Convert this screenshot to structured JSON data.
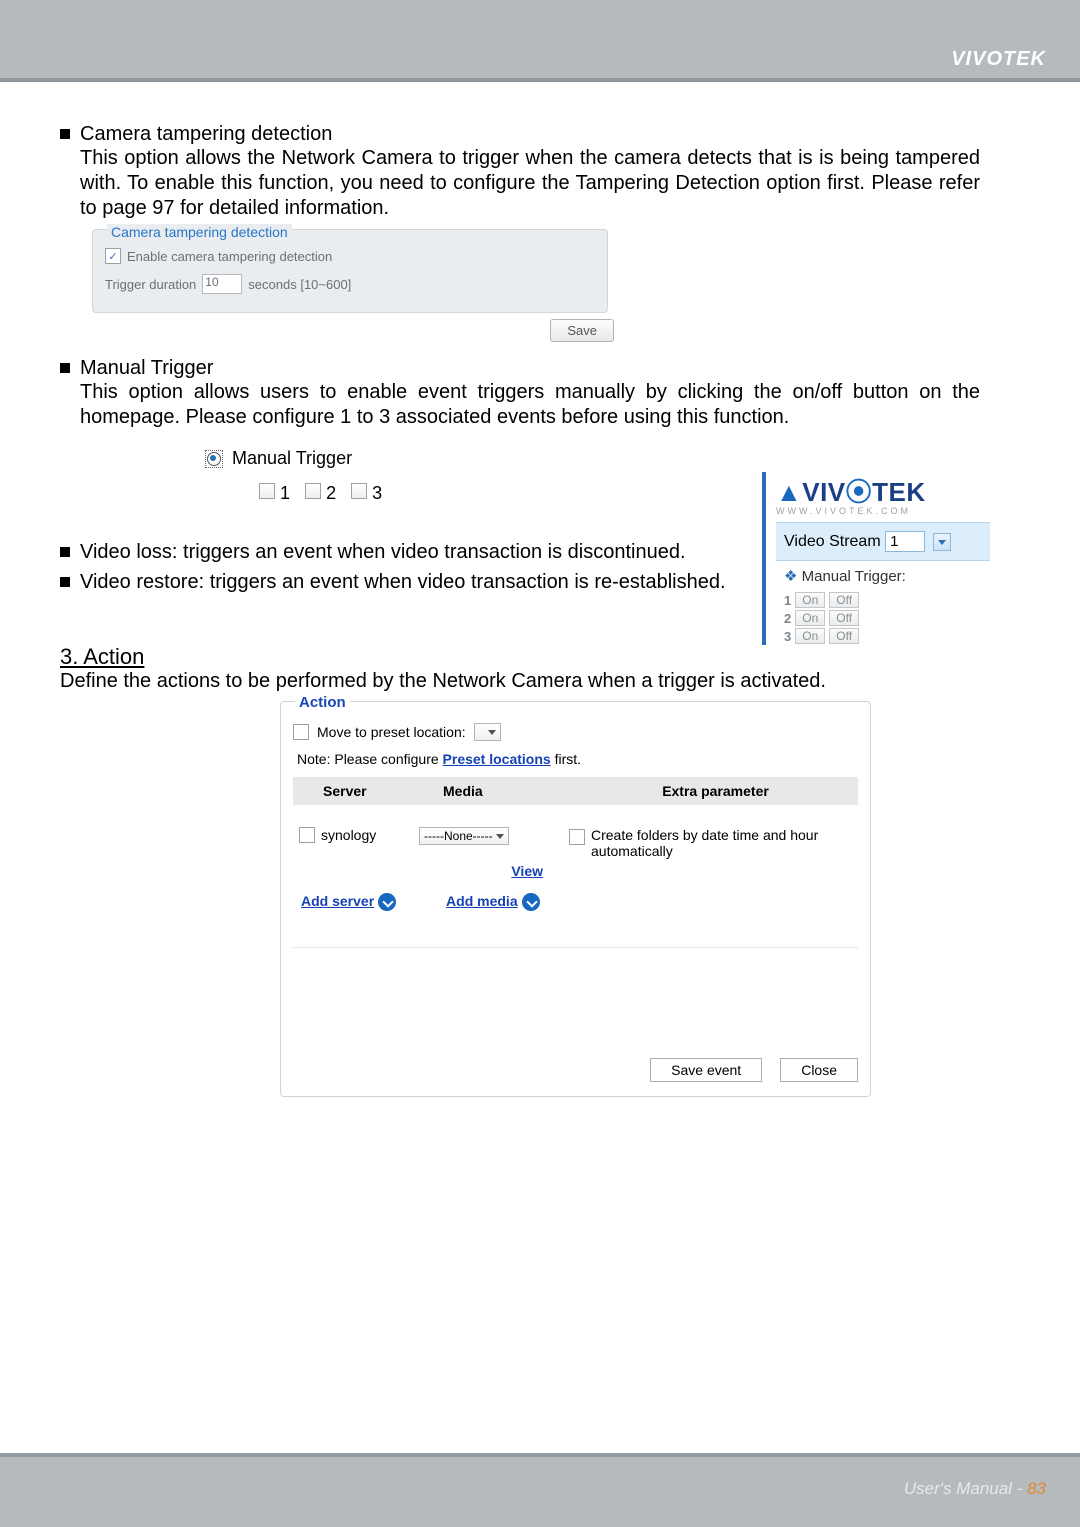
{
  "header": {
    "brand": "VIVOTEK"
  },
  "tampering": {
    "title": "Camera tampering detection",
    "description": "This option allows the Network Camera to trigger when the camera detects that is is being tampered with. To enable this function, you need to configure the Tampering Detection option first. Please refer to page 97 for detailed information.",
    "panel_title": "Camera tampering detection",
    "enable_label": "Enable camera tampering detection",
    "trigger_duration_label": "Trigger duration",
    "trigger_duration_value": "10",
    "trigger_duration_hint": "seconds [10~600]",
    "save_label": "Save"
  },
  "manual": {
    "title": "Manual Trigger",
    "description": "This option allows users to enable event triggers manually by clicking the on/off button on the homepage. Please configure 1 to 3 associated events before using this function.",
    "radio_label": "Manual Trigger",
    "opt1": "1",
    "opt2": "2",
    "opt3": "3"
  },
  "side": {
    "logo_text": "VIVOTEK",
    "sub": "WWW.VIVOTEK.COM",
    "video_stream_label": "Video Stream",
    "video_stream_value": "1",
    "mt_label": "Manual Trigger:",
    "rows": {
      "r1": {
        "n": "1",
        "on": "On",
        "off": "Off"
      },
      "r2": {
        "n": "2",
        "on": "On",
        "off": "Off"
      },
      "r3": {
        "n": "3",
        "on": "On",
        "off": "Off"
      }
    }
  },
  "video_loss": "Video loss: triggers an event when video transaction is discontinued.",
  "video_restore": "Video restore: triggers an event when video transaction is re-established.",
  "action": {
    "heading": "3. Action",
    "description": "Define the actions to be performed by the Network Camera when a trigger is activated.",
    "panel_title": "Action",
    "move_label": "Move to preset location:",
    "note_prefix": "Note: Please configure ",
    "note_link": "Preset locations",
    "note_suffix": " first.",
    "th_server": "Server",
    "th_media": "Media",
    "th_extra": "Extra parameter",
    "row_server": "synology",
    "row_media": "-----None-----",
    "row_extra": "Create folders by date time and hour automatically",
    "view_label": "View",
    "add_server": "Add server",
    "add_media": "Add media",
    "save_event": "Save event",
    "close": "Close"
  },
  "footer": {
    "label": "User's Manual - ",
    "page": "83"
  }
}
